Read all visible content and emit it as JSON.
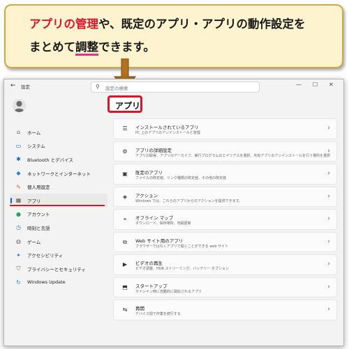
{
  "callout": {
    "line1_red": "アプリの管理",
    "line1_rest": "や、既定のアプリ・アプリの動作設定を",
    "line2_pre": "まとめて",
    "line2_ul": "調整",
    "line2_post": "できます。"
  },
  "window": {
    "app_title": "設定",
    "search_placeholder": "設定の検索",
    "controls": [
      "—",
      "☐",
      "✕"
    ],
    "page_title": "アプリ"
  },
  "nav": [
    {
      "label": "ホーム",
      "icon": "home-icon",
      "color": "#555555"
    },
    {
      "label": "システム",
      "icon": "system-icon",
      "color": "#0067c0"
    },
    {
      "label": "Bluetooth とデバイス",
      "icon": "bluetooth-icon",
      "color": "#0067c0"
    },
    {
      "label": "ネットワークとインターネット",
      "icon": "network-icon",
      "color": "#2a7bd1"
    },
    {
      "label": "個人用設定",
      "icon": "personalization-icon",
      "color": "#c06a24"
    },
    {
      "label": "アプリ",
      "icon": "apps-icon",
      "color": "#555555"
    },
    {
      "label": "アカウント",
      "icon": "account-icon",
      "color": "#2aa06a"
    },
    {
      "label": "時刻と言語",
      "icon": "time-language-icon",
      "color": "#2a7bd1"
    },
    {
      "label": "ゲーム",
      "icon": "gaming-icon",
      "color": "#666666"
    },
    {
      "label": "アクセシビリティ",
      "icon": "accessibility-icon",
      "color": "#2a7bd1"
    },
    {
      "label": "プライバシーとセキュリティ",
      "icon": "privacy-icon",
      "color": "#666666"
    },
    {
      "label": "Windows Update",
      "icon": "windows-update-icon",
      "color": "#2a7bd1"
    }
  ],
  "cards": [
    {
      "title": "インストールされているアプリ",
      "subtitle": "PC 上のアプリのアンインストールと管理",
      "icon": "installed-apps-icon"
    },
    {
      "title": "アプリの詳細設定",
      "subtitle": "アプリの取得、アプリのアーカイブ、実行プログラムのエイリアスを選択、共有アプリのアンインストールを行う場所を選択",
      "icon": "advanced-settings-icon"
    },
    {
      "title": "既定のアプリ",
      "subtitle": "ファイルの既定値、リンク種類の既定値、その他の既定値",
      "icon": "default-apps-icon"
    },
    {
      "title": "アクション",
      "subtitle": "Windows では、これらのアプリからのアクションを提供できます。",
      "icon": "actions-icon"
    },
    {
      "title": "オフライン マップ",
      "subtitle": "ダウンロード、保存場所、地図更新",
      "icon": "offline-maps-icon"
    },
    {
      "title": "Web サイト用のアプリ",
      "subtitle": "ブラウザーではなくアプリで開くことができる web サイト",
      "icon": "web-apps-icon"
    },
    {
      "title": "ビデオの再生",
      "subtitle": "ビデオ調整、HDR ストリーミング、バッテリー オプション",
      "icon": "video-playback-icon"
    },
    {
      "title": "スタートアップ",
      "subtitle": "サインイン時に自動的に開始されるアプリ",
      "icon": "startup-icon"
    },
    {
      "title": "再開",
      "subtitle": "デバイス間で作業を続行する",
      "icon": "resume-icon"
    }
  ]
}
